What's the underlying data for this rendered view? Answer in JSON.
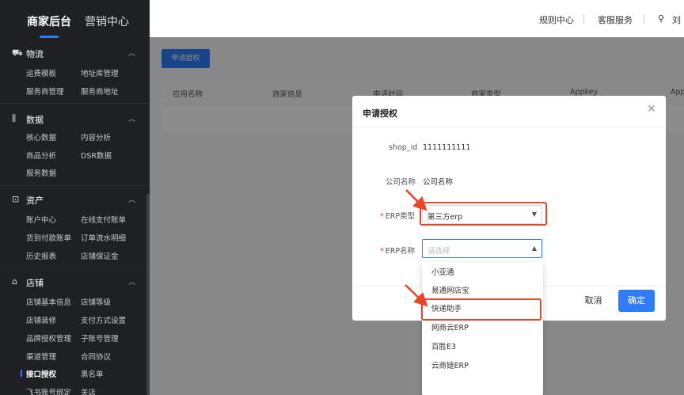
{
  "sidebar": {
    "tabs": [
      {
        "label": "商家后台"
      },
      {
        "label": "营销中心"
      }
    ],
    "sections": [
      {
        "title": "物流",
        "icon": "truck-icon",
        "items": [
          "运费模板",
          "地址库管理",
          "服务商管理",
          "服务商地址"
        ]
      },
      {
        "title": "数据",
        "icon": "bar-chart-icon",
        "items": [
          "核心数据",
          "内容分析",
          "商品分析",
          "DSR数据",
          "服务数据"
        ]
      },
      {
        "title": "资产",
        "icon": "wallet-icon",
        "items": [
          "账户中心",
          "在线支付账单",
          "货到付款账单",
          "订单流水明细",
          "历史报表",
          "店铺保证金"
        ]
      },
      {
        "title": "店铺",
        "icon": "store-icon",
        "items": [
          "店铺基本信息",
          "店铺等级",
          "店铺装修",
          "支付方式设置",
          "品牌授权管理",
          "子账号管理",
          "渠道管理",
          "合同协议",
          "接口授权",
          "黑名单",
          "飞书账号绑定",
          "关店"
        ]
      }
    ],
    "active_item": "接口授权"
  },
  "header": {
    "links": [
      "规则中心",
      "客服服务"
    ],
    "user": "刘"
  },
  "page": {
    "apply_button": "申请授权",
    "table_headers": [
      "应用名称",
      "商家信息",
      "申请时间",
      "商家类型",
      "Appkey",
      "App"
    ]
  },
  "modal": {
    "title": "申请授权",
    "fields": {
      "shop_id": {
        "label": "shop_id",
        "value": "1111111111"
      },
      "company": {
        "label": "公司名称",
        "value": "公司名称"
      },
      "erp_type": {
        "label": "ERP类型",
        "value": "第三方erp"
      },
      "erp_name": {
        "label": "ERP名称",
        "placeholder": "请选择"
      }
    },
    "cancel_label": "取消",
    "confirm_label": "确定",
    "dropdown_options": [
      "小亚通",
      "易通网店宝",
      "快递助手",
      "网商云ERP",
      "百胜E3",
      "云商链ERP"
    ],
    "highlighted_option": "快递助手"
  },
  "colors": {
    "primary": "#2f7cf6",
    "annotation": "#e8462a",
    "sidebar_bg": "#1f2023"
  }
}
